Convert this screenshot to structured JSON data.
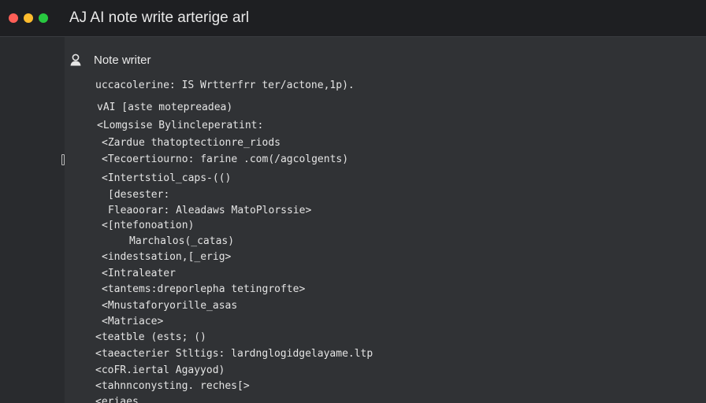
{
  "window": {
    "title": "AJ AI note write arterige arl"
  },
  "panel": {
    "title": "Note writer"
  },
  "code_lines": [
    "uccacolerine: IS Wrtterfrr ter/actone,1p).",
    "vAI [aste motepreadea)",
    "<Lomgsise Bylincleperatint:",
    "<Zardue thatoptectionre_riods",
    "<Tecoertiourno: farine .com(/agcolgents)",
    "<Intertstiol_caps-(()",
    "[desester:",
    "Fleaoorar: Aleadaws MatoPlorssie>",
    "<[ntefonoation)",
    "Marchalos(_catas)",
    "<indestsation,[_erig>",
    "<Intraleater",
    "<tantems:dreporlepha tetingrofte>",
    "<Mnustaforyorille_asas",
    "<Matriace>",
    "<teatble (ests; ()",
    "<taeacterier Stltigs: lardnglogidgelayame.ltp",
    "<coFR.iertal Agayyod)",
    "<tahnnconysting. reches[>",
    "<eriaes"
  ],
  "icons": {
    "user": "user-icon"
  },
  "colors": {
    "close": "#ff5f57",
    "minimize": "#febc2e",
    "maximize": "#28c840"
  }
}
